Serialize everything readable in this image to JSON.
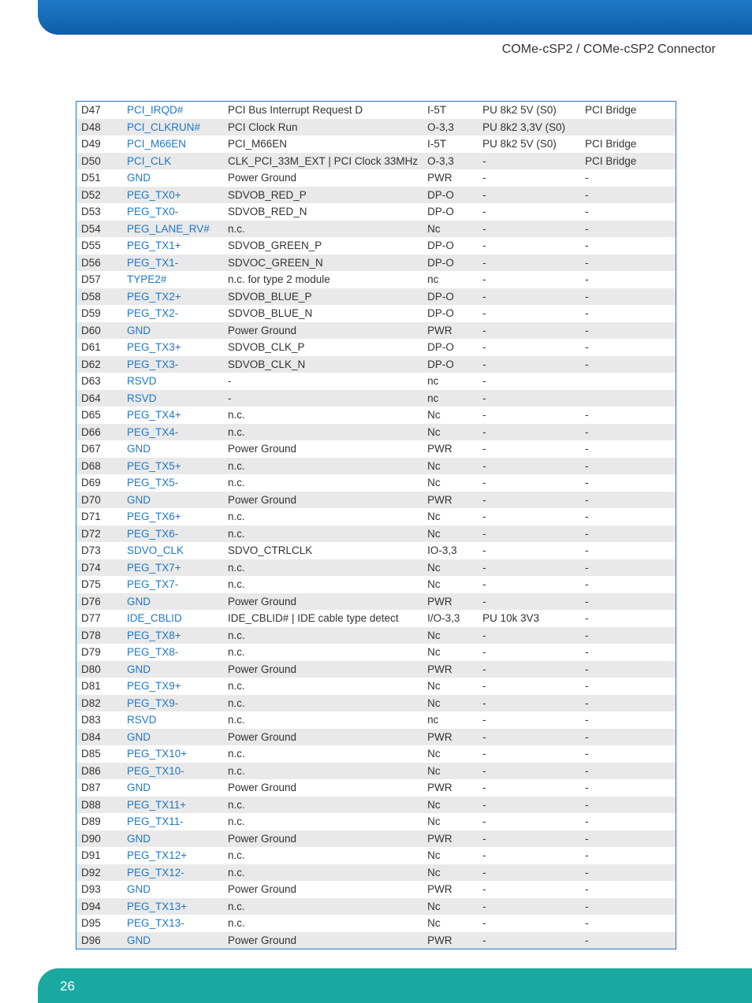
{
  "header": {
    "title": "COMe-cSP2 / COMe-cSP2 Connector"
  },
  "footer": {
    "page": "26"
  },
  "table": {
    "rows": [
      {
        "c0": "D47",
        "c1": "PCI_IRQD#",
        "c2": "PCI Bus Interrupt Request D",
        "c3": "I-5T",
        "c4": "PU 8k2 5V (S0)",
        "c5": "PCI Bridge"
      },
      {
        "c0": "D48",
        "c1": "PCI_CLKRUN#",
        "c2": "PCI Clock Run",
        "c3": "O-3,3",
        "c4": "PU 8k2 3,3V (S0)",
        "c5": ""
      },
      {
        "c0": "D49",
        "c1": "PCI_M66EN",
        "c2": "PCI_M66EN",
        "c3": "I-5T",
        "c4": "PU 8k2 5V (S0)",
        "c5": "PCI Bridge"
      },
      {
        "c0": "D50",
        "c1": "PCI_CLK",
        "c2": "CLK_PCI_33M_EXT | PCI Clock 33MHz",
        "c3": "O-3,3",
        "c4": "-",
        "c5": "PCI Bridge"
      },
      {
        "c0": "D51",
        "c1": "GND",
        "c2": "Power Ground",
        "c3": "PWR",
        "c4": "-",
        "c5": "-"
      },
      {
        "c0": "D52",
        "c1": "PEG_TX0+",
        "c2": "SDVOB_RED_P",
        "c3": "DP-O",
        "c4": "-",
        "c5": "-"
      },
      {
        "c0": "D53",
        "c1": "PEG_TX0-",
        "c2": "SDVOB_RED_N",
        "c3": "DP-O",
        "c4": "-",
        "c5": "-"
      },
      {
        "c0": "D54",
        "c1": "PEG_LANE_RV#",
        "c2": "n.c.",
        "c3": "Nc",
        "c4": "-",
        "c5": "-"
      },
      {
        "c0": "D55",
        "c1": "PEG_TX1+",
        "c2": "SDVOB_GREEN_P",
        "c3": "DP-O",
        "c4": "-",
        "c5": "-"
      },
      {
        "c0": "D56",
        "c1": "PEG_TX1-",
        "c2": "SDVOC_GREEN_N",
        "c3": "DP-O",
        "c4": "-",
        "c5": "-"
      },
      {
        "c0": "D57",
        "c1": "TYPE2#",
        "c2": "n.c. for type 2 module",
        "c3": "nc",
        "c4": "-",
        "c5": "-"
      },
      {
        "c0": "D58",
        "c1": "PEG_TX2+",
        "c2": "SDVOB_BLUE_P",
        "c3": "DP-O",
        "c4": "-",
        "c5": "-"
      },
      {
        "c0": "D59",
        "c1": "PEG_TX2-",
        "c2": "SDVOB_BLUE_N",
        "c3": "DP-O",
        "c4": "-",
        "c5": "-"
      },
      {
        "c0": "D60",
        "c1": "GND",
        "c2": "Power Ground",
        "c3": "PWR",
        "c4": "-",
        "c5": "-"
      },
      {
        "c0": "D61",
        "c1": "PEG_TX3+",
        "c2": "SDVOB_CLK_P",
        "c3": "DP-O",
        "c4": "-",
        "c5": "-"
      },
      {
        "c0": "D62",
        "c1": "PEG_TX3-",
        "c2": "SDVOB_CLK_N",
        "c3": "DP-O",
        "c4": "-",
        "c5": "-"
      },
      {
        "c0": "D63",
        "c1": "RSVD",
        "c2": "-",
        "c3": "nc",
        "c4": "-",
        "c5": ""
      },
      {
        "c0": "D64",
        "c1": "RSVD",
        "c2": "-",
        "c3": "nc",
        "c4": "-",
        "c5": ""
      },
      {
        "c0": "D65",
        "c1": "PEG_TX4+",
        "c2": "n.c.",
        "c3": "Nc",
        "c4": "-",
        "c5": "-"
      },
      {
        "c0": "D66",
        "c1": "PEG_TX4-",
        "c2": "n.c.",
        "c3": "Nc",
        "c4": "-",
        "c5": "-"
      },
      {
        "c0": "D67",
        "c1": "GND",
        "c2": "Power Ground",
        "c3": "PWR",
        "c4": "-",
        "c5": "-"
      },
      {
        "c0": "D68",
        "c1": "PEG_TX5+",
        "c2": "n.c.",
        "c3": "Nc",
        "c4": "-",
        "c5": "-"
      },
      {
        "c0": "D69",
        "c1": "PEG_TX5-",
        "c2": "n.c.",
        "c3": "Nc",
        "c4": "-",
        "c5": "-"
      },
      {
        "c0": "D70",
        "c1": "GND",
        "c2": "Power Ground",
        "c3": "PWR",
        "c4": "-",
        "c5": "-"
      },
      {
        "c0": "D71",
        "c1": "PEG_TX6+",
        "c2": "n.c.",
        "c3": "Nc",
        "c4": "-",
        "c5": "-"
      },
      {
        "c0": "D72",
        "c1": "PEG_TX6-",
        "c2": "n.c.",
        "c3": "Nc",
        "c4": "-",
        "c5": "-"
      },
      {
        "c0": "D73",
        "c1": "SDVO_CLK",
        "c2": "SDVO_CTRLCLK",
        "c3": "IO-3,3",
        "c4": "-",
        "c5": "-"
      },
      {
        "c0": "D74",
        "c1": "PEG_TX7+",
        "c2": "n.c.",
        "c3": "Nc",
        "c4": "-",
        "c5": "-"
      },
      {
        "c0": "D75",
        "c1": "PEG_TX7-",
        "c2": "n.c.",
        "c3": "Nc",
        "c4": "-",
        "c5": "-"
      },
      {
        "c0": "D76",
        "c1": "GND",
        "c2": "Power Ground",
        "c3": "PWR",
        "c4": "-",
        "c5": "-"
      },
      {
        "c0": "D77",
        "c1": "IDE_CBLID",
        "c2": "IDE_CBLID# | IDE cable type detect",
        "c3": "I/O-3,3",
        "c4": "PU 10k 3V3",
        "c5": "-"
      },
      {
        "c0": "D78",
        "c1": "PEG_TX8+",
        "c2": "n.c.",
        "c3": "Nc",
        "c4": "-",
        "c5": "-"
      },
      {
        "c0": "D79",
        "c1": "PEG_TX8-",
        "c2": "n.c.",
        "c3": "Nc",
        "c4": "-",
        "c5": "-"
      },
      {
        "c0": "D80",
        "c1": "GND",
        "c2": "Power Ground",
        "c3": "PWR",
        "c4": "-",
        "c5": "-"
      },
      {
        "c0": "D81",
        "c1": "PEG_TX9+",
        "c2": "n.c.",
        "c3": "Nc",
        "c4": "-",
        "c5": "-"
      },
      {
        "c0": "D82",
        "c1": "PEG_TX9-",
        "c2": "n.c.",
        "c3": "Nc",
        "c4": "-",
        "c5": "-"
      },
      {
        "c0": "D83",
        "c1": "RSVD",
        "c2": "n.c.",
        "c3": "nc",
        "c4": "-",
        "c5": "-"
      },
      {
        "c0": "D84",
        "c1": "GND",
        "c2": "Power Ground",
        "c3": "PWR",
        "c4": "-",
        "c5": "-"
      },
      {
        "c0": "D85",
        "c1": "PEG_TX10+",
        "c2": "n.c.",
        "c3": "Nc",
        "c4": "-",
        "c5": "-"
      },
      {
        "c0": "D86",
        "c1": "PEG_TX10-",
        "c2": "n.c.",
        "c3": "Nc",
        "c4": "-",
        "c5": "-"
      },
      {
        "c0": "D87",
        "c1": "GND",
        "c2": "Power Ground",
        "c3": "PWR",
        "c4": "-",
        "c5": "-"
      },
      {
        "c0": "D88",
        "c1": "PEG_TX11+",
        "c2": "n.c.",
        "c3": "Nc",
        "c4": "-",
        "c5": "-"
      },
      {
        "c0": "D89",
        "c1": "PEG_TX11-",
        "c2": "n.c.",
        "c3": "Nc",
        "c4": "-",
        "c5": "-"
      },
      {
        "c0": "D90",
        "c1": "GND",
        "c2": "Power Ground",
        "c3": "PWR",
        "c4": "-",
        "c5": "-"
      },
      {
        "c0": "D91",
        "c1": "PEG_TX12+",
        "c2": "n.c.",
        "c3": "Nc",
        "c4": "-",
        "c5": "-"
      },
      {
        "c0": "D92",
        "c1": "PEG_TX12-",
        "c2": "n.c.",
        "c3": "Nc",
        "c4": "-",
        "c5": "-"
      },
      {
        "c0": "D93",
        "c1": "GND",
        "c2": "Power Ground",
        "c3": "PWR",
        "c4": "-",
        "c5": "-"
      },
      {
        "c0": "D94",
        "c1": "PEG_TX13+",
        "c2": "n.c.",
        "c3": "Nc",
        "c4": "-",
        "c5": "-"
      },
      {
        "c0": "D95",
        "c1": "PEG_TX13-",
        "c2": "n.c.",
        "c3": "Nc",
        "c4": "-",
        "c5": "-"
      },
      {
        "c0": "D96",
        "c1": "GND",
        "c2": "Power Ground",
        "c3": "PWR",
        "c4": "-",
        "c5": "-"
      }
    ]
  }
}
